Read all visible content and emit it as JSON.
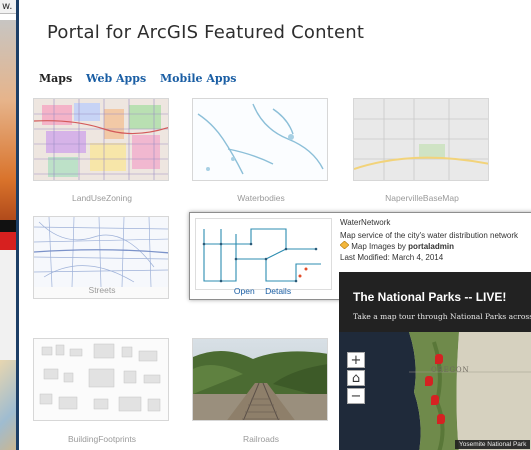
{
  "background_window": {
    "address_fragment": "w."
  },
  "portal": {
    "title": "Portal for ArcGIS Featured Content",
    "tabs": [
      "Maps",
      "Web Apps",
      "Mobile Apps"
    ]
  },
  "items": [
    {
      "caption": "LandUseZoning"
    },
    {
      "caption": "Waterbodies"
    },
    {
      "caption": "NapervilleBaseMap"
    },
    {
      "caption": "Streets"
    },
    {
      "caption": "BuildingFootprints"
    },
    {
      "caption": "Railroads"
    }
  ],
  "popup": {
    "name": "WaterNetwork",
    "description": "Map service of the city's water distribution network",
    "type_prefix": "Map Images by",
    "owner": "portaladmin",
    "modified": "Last Modified: March 4, 2014",
    "open_label": "Open",
    "details_label": "Details"
  },
  "national_parks": {
    "title": "The National Parks -- LIVE!",
    "subtitle": "Take a map tour through National Parks across th",
    "zoom_in": "+",
    "home": "⌂",
    "zoom_out": "−",
    "map_label": "OREGON",
    "tooltip": "Yosemite National Park"
  },
  "colors": {
    "link": "#1a5ea4",
    "frame": "#1c3e66",
    "pin": "#d52222"
  }
}
